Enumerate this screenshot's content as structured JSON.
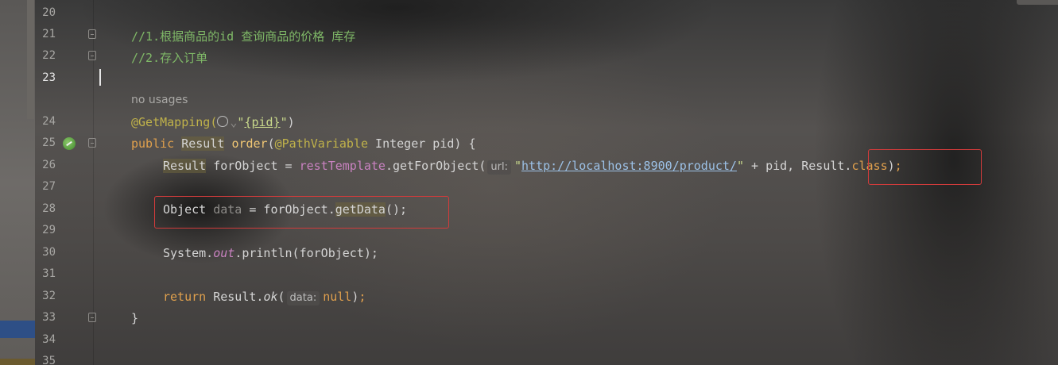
{
  "editor": {
    "lines": [
      {
        "num": "20"
      },
      {
        "num": "21",
        "comment": "//1.根据商品的id 查询商品的价格 库存"
      },
      {
        "num": "22",
        "comment": "//2.存入订单"
      },
      {
        "num": "23"
      },
      {
        "usages": "no usages"
      },
      {
        "num": "24",
        "annotation": "@GetMapping(",
        "path_value": "{pid}"
      },
      {
        "num": "25",
        "kw_public": "public",
        "type": "Result",
        "method": "order",
        "param_anno": "@PathVariable",
        "param_rest": " Integer pid) {"
      },
      {
        "num": "26",
        "type": "Result",
        "var": " forObject = ",
        "field": "restTemplate",
        "call": ".getForObject(",
        "hint": "url:",
        "url": "http://localhost:8900/product/",
        "tail": " + pid, ",
        "cls": "Result",
        "cls_kw": "class"
      },
      {
        "num": "27"
      },
      {
        "num": "28",
        "type": "Object",
        "var": "data",
        "assign": " = forObject.",
        "method": "getData",
        "tail": "();"
      },
      {
        "num": "29"
      },
      {
        "num": "30",
        "cls": "System.",
        "field": "out",
        "call": ".println(forObject);"
      },
      {
        "num": "31"
      },
      {
        "num": "32",
        "kw": "return",
        "call": " Result.",
        "method": "ok",
        "hint": "data:",
        "value": "null"
      },
      {
        "num": "33",
        "brace": "}"
      },
      {
        "num": "34"
      },
      {
        "num": "35"
      }
    ]
  },
  "colors": {
    "highlight_box": "#d23b3b",
    "comment": "#7fb867",
    "keyword": "#e0a04d",
    "annotation": "#c0b24a"
  },
  "icons": [
    "run-gutter-icon",
    "fold-icon",
    "globe-icon"
  ]
}
